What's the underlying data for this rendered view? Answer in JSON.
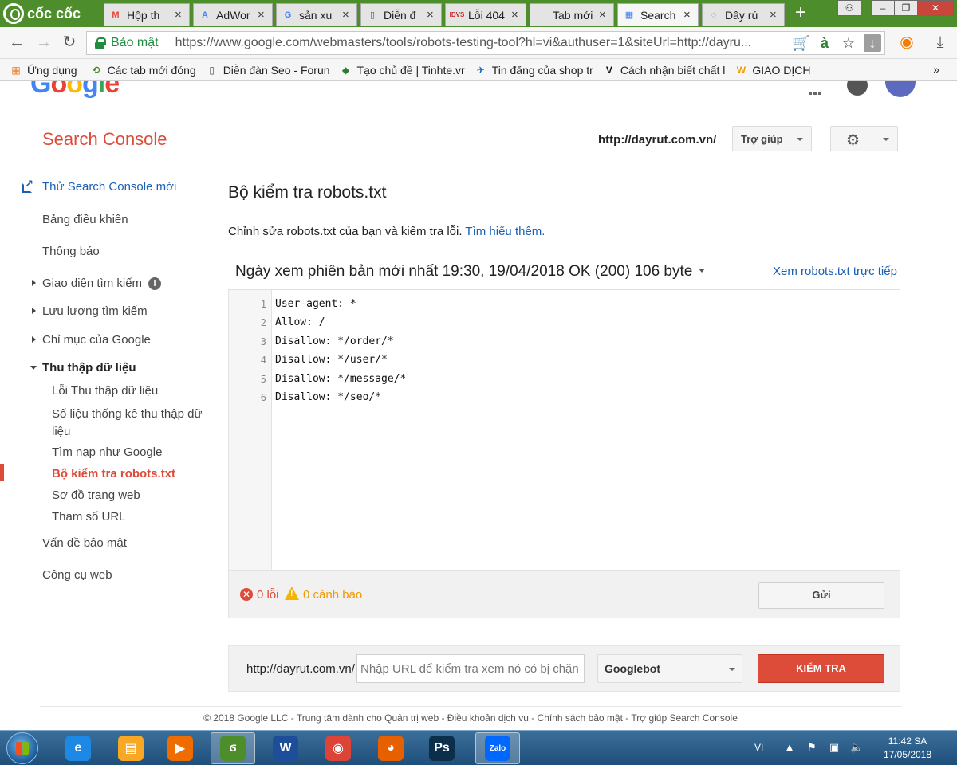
{
  "browser": {
    "brand": "cốc cốc",
    "tabs": [
      {
        "label": "Hộp th",
        "icon": "gmail-icon",
        "glyph": "M",
        "color": "#ea4335"
      },
      {
        "label": "AdWor",
        "icon": "adwords-icon",
        "glyph": "A",
        "color": "#4285f4"
      },
      {
        "label": "sản xu",
        "icon": "google-icon",
        "glyph": "G",
        "color": "#4285f4"
      },
      {
        "label": "Diễn đ",
        "icon": "page-icon",
        "glyph": "▯",
        "color": "#555555"
      },
      {
        "label": "Lỗi 404",
        "icon": "idvs-icon",
        "glyph": "IDVS",
        "color": "#c62828"
      },
      {
        "label": "Tab mới",
        "icon": "mute-icon",
        "glyph": "",
        "color": "#555555"
      },
      {
        "label": "Search",
        "icon": "search-console-icon",
        "glyph": "▦",
        "color": "#4285f4"
      },
      {
        "label": "Dây rú",
        "icon": "loading-icon",
        "glyph": "◌",
        "color": "#777777"
      }
    ],
    "new_tab": "+",
    "url": "https://www.google.com/webmasters/tools/robots-testing-tool?hl=vi&authuser=1&siteUrl=http://dayru...",
    "secure_label": "Bảo mật",
    "bookmarks": [
      {
        "label": "Ứng dụng",
        "icon": "apps-grid-icon",
        "glyph": "▦",
        "color": "#e8710a"
      },
      {
        "label": "Các tab mới đóng",
        "icon": "recent-tabs-icon",
        "glyph": "⟲",
        "color": "#4e8d2c"
      },
      {
        "label": "Diễn đàn Seo - Forun",
        "icon": "page-icon",
        "glyph": "▯",
        "color": "#555555"
      },
      {
        "label": "Tạo chủ đề | Tinhte.vr",
        "icon": "tinhte-icon",
        "glyph": "◆",
        "color": "#2e7d32"
      },
      {
        "label": "Tin đăng của shop tr",
        "icon": "shop-icon",
        "glyph": "✈",
        "color": "#1565c0"
      },
      {
        "label": "Cách nhận biết chất l",
        "icon": "v-logo-icon",
        "glyph": "V",
        "color": "#111111"
      },
      {
        "label": "GIAO DỊCH",
        "icon": "w-logo-icon",
        "glyph": "W",
        "color": "#f29900"
      }
    ],
    "more_bookmarks": "»"
  },
  "google_logo": [
    "G",
    "o",
    "o",
    "g",
    "l",
    "e"
  ],
  "header": {
    "title": "Search Console",
    "site": "http://dayrut.com.vn/",
    "help_label": "Trợ giúp"
  },
  "sidebar": {
    "try_new": "Thử Search Console mới",
    "dashboard": "Bảng điều khiển",
    "messages": "Thông báo",
    "search_appearance": "Giao diện tìm kiếm",
    "search_traffic": "Lưu lượng tìm kiếm",
    "google_index": "Chỉ mục của Google",
    "crawl": "Thu thập dữ liệu",
    "crawl_items": [
      "Lỗi Thu thập dữ liệu",
      "Số liệu thống kê thu thập dữ liệu",
      "Tìm nạp như Google",
      "Bộ kiểm tra robots.txt",
      "Sơ đồ trang web",
      "Tham số URL"
    ],
    "security_issues": "Vấn đề bảo mật",
    "web_tools": "Công cụ web"
  },
  "main": {
    "title": "Bộ kiểm tra robots.txt",
    "description": "Chỉnh sửa robots.txt của bạn và kiểm tra lỗi.",
    "learn_more": "Tìm hiểu thêm.",
    "version": "Ngày xem phiên bản mới nhất 19:30, 19/04/2018 OK (200) 106 byte",
    "live_link": "Xem robots.txt trực tiếp",
    "lines": [
      {
        "n": "1",
        "text": "User-agent: *"
      },
      {
        "n": "2",
        "text": "Allow: /"
      },
      {
        "n": "3",
        "text": "Disallow: */order/*"
      },
      {
        "n": "4",
        "text": "Disallow: */user/*"
      },
      {
        "n": "5",
        "text": "Disallow: */message/*"
      },
      {
        "n": "6",
        "text": "Disallow: */seo/*"
      }
    ],
    "errors": "0 lỗi",
    "warnings": "0 cảnh báo",
    "submit_label": "Gửi",
    "tester_prefix": "http://dayrut.com.vn/",
    "tester_placeholder": "Nhập URL để kiểm tra xem nó có bị chặn",
    "bot": "Googlebot",
    "test_label": "KIỂM TRA"
  },
  "footer": "© 2018 Google LLC - Trung tâm dành cho Quản trị web - Điều khoản dịch vụ - Chính sách bảo mật - Trợ giúp Search Console",
  "taskbar": {
    "apps": [
      {
        "icon": "ie-icon",
        "glyph": "e",
        "color": "#1e88e5"
      },
      {
        "icon": "explorer-folder-icon",
        "glyph": "▤",
        "color": "#f9a825"
      },
      {
        "icon": "media-player-icon",
        "glyph": "▶",
        "color": "#ef6c00"
      },
      {
        "icon": "coccoc-icon",
        "glyph": "ϭ",
        "color": "#4e8d2c"
      },
      {
        "icon": "word-icon",
        "glyph": "W",
        "color": "#1e4e9a"
      },
      {
        "icon": "chrome-icon",
        "glyph": "◉",
        "color": "#db4437"
      },
      {
        "icon": "firefox-icon",
        "glyph": "◕",
        "color": "#e66000"
      },
      {
        "icon": "photoshop-icon",
        "glyph": "Ps",
        "color": "#0b2e4a"
      },
      {
        "icon": "zalo-icon",
        "glyph": "Zalo",
        "color": "#0068ff"
      }
    ],
    "lang": "VI",
    "time": "11:42 SA",
    "date": "17/05/2018"
  }
}
